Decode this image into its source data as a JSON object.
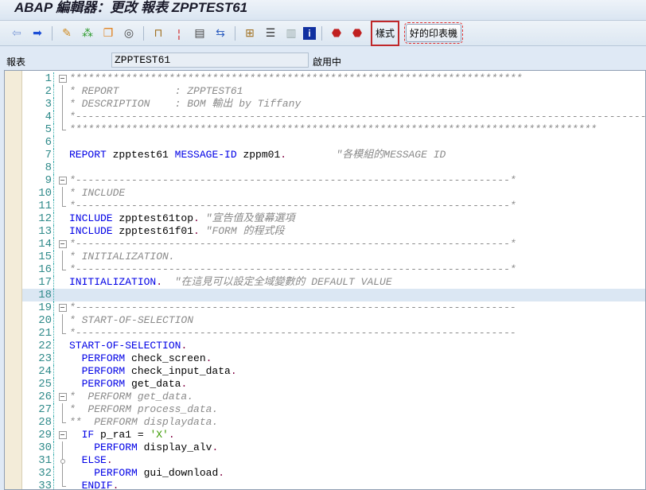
{
  "title": "ABAP 編輯器：更改 報表 ZPPTEST61",
  "toolbar": {
    "icons": [
      "back-arrow-icon",
      "forward-arrow-icon",
      "edit-pencil-icon",
      "toggle-display-change-icon",
      "other-object-icon",
      "activate-icon",
      "check-icon",
      "where-used-icon",
      "display-object-list-icon",
      "navigate-icon",
      "hierarchy-icon",
      "pattern-icon",
      "list-icon",
      "info-icon",
      "stop-help-icon",
      "stop-user-icon"
    ],
    "style_label": "樣式",
    "print_label": "好的印表機"
  },
  "field": {
    "label": "報表",
    "value": "ZPPTEST61",
    "status": "啟用中"
  },
  "editor": {
    "highlighted_line": 18,
    "lines": [
      {
        "n": "1",
        "fold": "box",
        "seg": [
          [
            "cm",
            "*************************************************************************"
          ]
        ]
      },
      {
        "n": "2",
        "fold": "bar",
        "seg": [
          [
            "cm",
            "* REPORT         : ZPPTEST61"
          ]
        ]
      },
      {
        "n": "3",
        "fold": "bar",
        "seg": [
          [
            "cm",
            "* DESCRIPTION    : BOM 輸出 by Tiffany"
          ]
        ]
      },
      {
        "n": "4",
        "fold": "bar",
        "seg": [
          [
            "cm",
            "*-----------------------------------------------------------------------------------------------------"
          ]
        ]
      },
      {
        "n": "5",
        "fold": "end",
        "seg": [
          [
            "cm",
            "*************************************************************************************"
          ]
        ]
      },
      {
        "n": "6",
        "fold": "",
        "seg": []
      },
      {
        "n": "7",
        "fold": "",
        "seg": [
          [
            "kw",
            "REPORT"
          ],
          [
            "id",
            " zpptest61 "
          ],
          [
            "kw",
            "MESSAGE-ID"
          ],
          [
            "id",
            " zppm01"
          ],
          [
            "pt",
            "."
          ],
          [
            "id",
            "        "
          ],
          [
            "cm",
            "\"各模組的MESSAGE ID"
          ]
        ]
      },
      {
        "n": "8",
        "fold": "",
        "seg": []
      },
      {
        "n": "9",
        "fold": "box",
        "seg": [
          [
            "cm",
            "*----------------------------------------------------------------------*"
          ]
        ]
      },
      {
        "n": "10",
        "fold": "bar",
        "seg": [
          [
            "cm",
            "* INCLUDE"
          ]
        ]
      },
      {
        "n": "11",
        "fold": "end",
        "seg": [
          [
            "cm",
            "*----------------------------------------------------------------------*"
          ]
        ]
      },
      {
        "n": "12",
        "fold": "",
        "seg": [
          [
            "kw",
            "INCLUDE"
          ],
          [
            "id",
            " zpptest61top"
          ],
          [
            "pt",
            "."
          ],
          [
            "id",
            " "
          ],
          [
            "cm",
            "\"宣告值及螢幕選項"
          ]
        ]
      },
      {
        "n": "13",
        "fold": "",
        "seg": [
          [
            "kw",
            "INCLUDE"
          ],
          [
            "id",
            " zpptest61f01"
          ],
          [
            "pt",
            "."
          ],
          [
            "id",
            " "
          ],
          [
            "cm",
            "\"FORM 的程式段"
          ]
        ]
      },
      {
        "n": "14",
        "fold": "box",
        "seg": [
          [
            "cm",
            "*----------------------------------------------------------------------*"
          ]
        ]
      },
      {
        "n": "15",
        "fold": "bar",
        "seg": [
          [
            "cm",
            "* INITIALIZATION."
          ]
        ]
      },
      {
        "n": "16",
        "fold": "end",
        "seg": [
          [
            "cm",
            "*----------------------------------------------------------------------*"
          ]
        ]
      },
      {
        "n": "17",
        "fold": "",
        "seg": [
          [
            "kw",
            "INITIALIZATION"
          ],
          [
            "pt",
            "."
          ],
          [
            "id",
            "  "
          ],
          [
            "cm",
            "\"在這見可以設定全域變數的 DEFAULT VALUE"
          ]
        ]
      },
      {
        "n": "18",
        "fold": "",
        "seg": []
      },
      {
        "n": "19",
        "fold": "box",
        "seg": [
          [
            "cm",
            "*-----------------------------------------------------------------------"
          ]
        ]
      },
      {
        "n": "20",
        "fold": "bar",
        "seg": [
          [
            "cm",
            "* START-OF-SELECTION"
          ]
        ]
      },
      {
        "n": "21",
        "fold": "end",
        "seg": [
          [
            "cm",
            "*-----------------------------------------------------------------------"
          ]
        ]
      },
      {
        "n": "22",
        "fold": "",
        "seg": [
          [
            "kw",
            "START-OF-SELECTION"
          ],
          [
            "pt",
            "."
          ]
        ]
      },
      {
        "n": "23",
        "fold": "",
        "seg": [
          [
            "id",
            "  "
          ],
          [
            "kw",
            "PERFORM"
          ],
          [
            "id",
            " check_screen"
          ],
          [
            "pt",
            "."
          ]
        ]
      },
      {
        "n": "24",
        "fold": "",
        "seg": [
          [
            "id",
            "  "
          ],
          [
            "kw",
            "PERFORM"
          ],
          [
            "id",
            " check_input_data"
          ],
          [
            "pt",
            "."
          ]
        ]
      },
      {
        "n": "25",
        "fold": "",
        "seg": [
          [
            "id",
            "  "
          ],
          [
            "kw",
            "PERFORM"
          ],
          [
            "id",
            " get_data"
          ],
          [
            "pt",
            "."
          ]
        ]
      },
      {
        "n": "26",
        "fold": "box",
        "seg": [
          [
            "cm",
            "*  PERFORM get_data."
          ]
        ]
      },
      {
        "n": "27",
        "fold": "bar",
        "seg": [
          [
            "cm",
            "*  PERFORM process_data."
          ]
        ]
      },
      {
        "n": "28",
        "fold": "end",
        "seg": [
          [
            "cm",
            "**  PERFORM displaydata."
          ]
        ]
      },
      {
        "n": "29",
        "fold": "box",
        "seg": [
          [
            "id",
            "  "
          ],
          [
            "kw",
            "IF"
          ],
          [
            "id",
            " p_ra1 = "
          ],
          [
            "st",
            "'X'"
          ],
          [
            "pt",
            "."
          ]
        ]
      },
      {
        "n": "30",
        "fold": "bar",
        "seg": [
          [
            "id",
            "    "
          ],
          [
            "kw",
            "PERFORM"
          ],
          [
            "id",
            " display_alv"
          ],
          [
            "pt",
            "."
          ]
        ]
      },
      {
        "n": "31",
        "fold": "mid",
        "seg": [
          [
            "id",
            "  "
          ],
          [
            "kw",
            "ELSE"
          ],
          [
            "pt",
            "."
          ]
        ]
      },
      {
        "n": "32",
        "fold": "bar",
        "seg": [
          [
            "id",
            "    "
          ],
          [
            "kw",
            "PERFORM"
          ],
          [
            "id",
            " gui_download"
          ],
          [
            "pt",
            "."
          ]
        ]
      },
      {
        "n": "33",
        "fold": "end",
        "seg": [
          [
            "id",
            "  "
          ],
          [
            "kw",
            "ENDIF"
          ],
          [
            "pt",
            "."
          ]
        ]
      }
    ]
  }
}
